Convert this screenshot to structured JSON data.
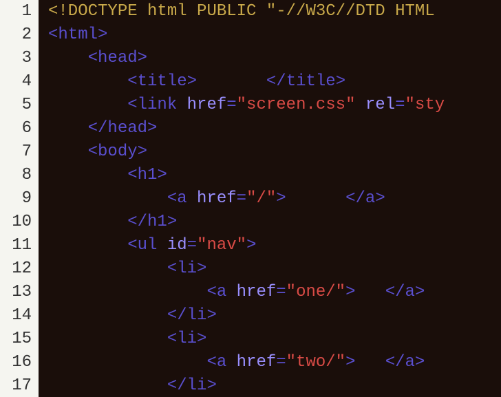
{
  "editor": {
    "gutter": [
      "1",
      "2",
      "3",
      "4",
      "5",
      "6",
      "7",
      "8",
      "9",
      "10",
      "11",
      "12",
      "13",
      "14",
      "15",
      "16",
      "17"
    ],
    "lines": [
      {
        "seg": [
          {
            "c": "doctype",
            "t": "<!DOCTYPE html PUBLIC \"-//W3C//DTD HTML"
          }
        ]
      },
      {
        "seg": [
          {
            "c": "punct",
            "t": "<"
          },
          {
            "c": "tag",
            "t": "html"
          },
          {
            "c": "punct",
            "t": ">"
          }
        ]
      },
      {
        "seg": [
          {
            "c": "",
            "t": "    "
          },
          {
            "c": "punct",
            "t": "<"
          },
          {
            "c": "tag",
            "t": "head"
          },
          {
            "c": "punct",
            "t": ">"
          }
        ]
      },
      {
        "seg": [
          {
            "c": "",
            "t": "        "
          },
          {
            "c": "punct",
            "t": "<"
          },
          {
            "c": "tag",
            "t": "title"
          },
          {
            "c": "punct",
            "t": ">"
          },
          {
            "c": "txt",
            "t": "       "
          },
          {
            "c": "punct",
            "t": "</"
          },
          {
            "c": "tag",
            "t": "title"
          },
          {
            "c": "punct",
            "t": ">"
          }
        ]
      },
      {
        "seg": [
          {
            "c": "",
            "t": "        "
          },
          {
            "c": "punct",
            "t": "<"
          },
          {
            "c": "tag",
            "t": "link"
          },
          {
            "c": "",
            "t": " "
          },
          {
            "c": "attr",
            "t": "href"
          },
          {
            "c": "punct",
            "t": "="
          },
          {
            "c": "str",
            "t": "\"screen.css\""
          },
          {
            "c": "",
            "t": " "
          },
          {
            "c": "attr",
            "t": "rel"
          },
          {
            "c": "punct",
            "t": "="
          },
          {
            "c": "str",
            "t": "\"sty"
          }
        ]
      },
      {
        "seg": [
          {
            "c": "",
            "t": "    "
          },
          {
            "c": "punct",
            "t": "</"
          },
          {
            "c": "tag",
            "t": "head"
          },
          {
            "c": "punct",
            "t": ">"
          }
        ]
      },
      {
        "seg": [
          {
            "c": "",
            "t": "    "
          },
          {
            "c": "punct",
            "t": "<"
          },
          {
            "c": "tag",
            "t": "body"
          },
          {
            "c": "punct",
            "t": ">"
          }
        ]
      },
      {
        "seg": [
          {
            "c": "",
            "t": "        "
          },
          {
            "c": "punct",
            "t": "<"
          },
          {
            "c": "tag",
            "t": "h1"
          },
          {
            "c": "punct",
            "t": ">"
          }
        ]
      },
      {
        "seg": [
          {
            "c": "",
            "t": "            "
          },
          {
            "c": "punct",
            "t": "<"
          },
          {
            "c": "tag",
            "t": "a"
          },
          {
            "c": "",
            "t": " "
          },
          {
            "c": "attr",
            "t": "href"
          },
          {
            "c": "punct",
            "t": "="
          },
          {
            "c": "str",
            "t": "\"/\""
          },
          {
            "c": "punct",
            "t": ">"
          },
          {
            "c": "txt",
            "t": "      "
          },
          {
            "c": "punct",
            "t": "</"
          },
          {
            "c": "tag",
            "t": "a"
          },
          {
            "c": "punct",
            "t": ">"
          }
        ]
      },
      {
        "seg": [
          {
            "c": "",
            "t": "        "
          },
          {
            "c": "punct",
            "t": "</"
          },
          {
            "c": "tag",
            "t": "h1"
          },
          {
            "c": "punct",
            "t": ">"
          }
        ]
      },
      {
        "seg": [
          {
            "c": "",
            "t": "        "
          },
          {
            "c": "punct",
            "t": "<"
          },
          {
            "c": "tag",
            "t": "ul"
          },
          {
            "c": "",
            "t": " "
          },
          {
            "c": "attr",
            "t": "id"
          },
          {
            "c": "punct",
            "t": "="
          },
          {
            "c": "str",
            "t": "\"nav\""
          },
          {
            "c": "punct",
            "t": ">"
          }
        ]
      },
      {
        "seg": [
          {
            "c": "",
            "t": "            "
          },
          {
            "c": "punct",
            "t": "<"
          },
          {
            "c": "tag",
            "t": "li"
          },
          {
            "c": "punct",
            "t": ">"
          }
        ]
      },
      {
        "seg": [
          {
            "c": "",
            "t": "                "
          },
          {
            "c": "punct",
            "t": "<"
          },
          {
            "c": "tag",
            "t": "a"
          },
          {
            "c": "",
            "t": " "
          },
          {
            "c": "attr",
            "t": "href"
          },
          {
            "c": "punct",
            "t": "="
          },
          {
            "c": "str",
            "t": "\"one/\""
          },
          {
            "c": "punct",
            "t": ">"
          },
          {
            "c": "txt",
            "t": "   "
          },
          {
            "c": "punct",
            "t": "</"
          },
          {
            "c": "tag",
            "t": "a"
          },
          {
            "c": "punct",
            "t": ">"
          }
        ]
      },
      {
        "seg": [
          {
            "c": "",
            "t": "            "
          },
          {
            "c": "punct",
            "t": "</"
          },
          {
            "c": "tag",
            "t": "li"
          },
          {
            "c": "punct",
            "t": ">"
          }
        ]
      },
      {
        "seg": [
          {
            "c": "",
            "t": "            "
          },
          {
            "c": "punct",
            "t": "<"
          },
          {
            "c": "tag",
            "t": "li"
          },
          {
            "c": "punct",
            "t": ">"
          }
        ]
      },
      {
        "seg": [
          {
            "c": "",
            "t": "                "
          },
          {
            "c": "punct",
            "t": "<"
          },
          {
            "c": "tag",
            "t": "a"
          },
          {
            "c": "",
            "t": " "
          },
          {
            "c": "attr",
            "t": "href"
          },
          {
            "c": "punct",
            "t": "="
          },
          {
            "c": "str",
            "t": "\"two/\""
          },
          {
            "c": "punct",
            "t": ">"
          },
          {
            "c": "txt",
            "t": "   "
          },
          {
            "c": "punct",
            "t": "</"
          },
          {
            "c": "tag",
            "t": "a"
          },
          {
            "c": "punct",
            "t": ">"
          }
        ]
      },
      {
        "seg": [
          {
            "c": "",
            "t": "            "
          },
          {
            "c": "punct",
            "t": "</"
          },
          {
            "c": "tag",
            "t": "li"
          },
          {
            "c": "punct",
            "t": ">"
          }
        ]
      }
    ]
  }
}
